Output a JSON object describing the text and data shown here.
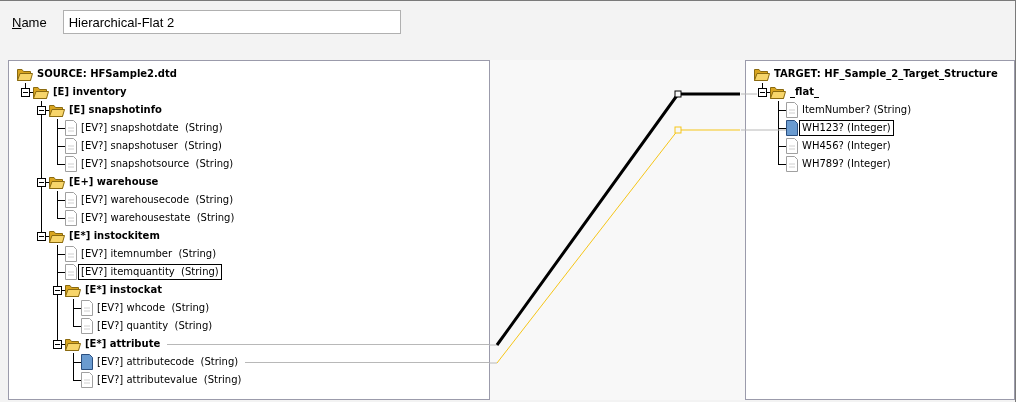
{
  "name_field": {
    "label": "Name",
    "value": "Hierarchical-Flat 2"
  },
  "source": {
    "root": {
      "label": "SOURCE: HFSample2.dtd",
      "kind": "folder",
      "mapped": false,
      "children": [
        {
          "label": "[E] inventory",
          "kind": "folder",
          "expanded": true,
          "mapped": false,
          "children": [
            {
              "label": "[E] snapshotinfo",
              "kind": "folder",
              "expanded": true,
              "mapped": false,
              "children": [
                {
                  "label": "[EV?] snapshotdate  (String)",
                  "kind": "field",
                  "mapped": false,
                  "selected": false,
                  "focused": false
                },
                {
                  "label": "[EV?] snapshotuser  (String)",
                  "kind": "field",
                  "mapped": false,
                  "selected": false,
                  "focused": false
                },
                {
                  "label": "[EV?] snapshotsource  (String)",
                  "kind": "field",
                  "mapped": false,
                  "selected": false,
                  "focused": false
                }
              ]
            },
            {
              "label": "[E+] warehouse",
              "kind": "folder",
              "expanded": true,
              "mapped": false,
              "children": [
                {
                  "label": "[EV?] warehousecode  (String)",
                  "kind": "field",
                  "mapped": false,
                  "selected": false,
                  "focused": false
                },
                {
                  "label": "[EV?] warehousestate  (String)",
                  "kind": "field",
                  "mapped": false,
                  "selected": false,
                  "focused": false
                }
              ]
            },
            {
              "label": "[E*] instockitem",
              "kind": "folder",
              "expanded": true,
              "mapped": false,
              "children": [
                {
                  "label": "[EV?] itemnumber  (String)",
                  "kind": "field",
                  "mapped": false,
                  "selected": false,
                  "focused": false
                },
                {
                  "label": "[EV?] itemquantity  (String)",
                  "kind": "field",
                  "mapped": false,
                  "selected": false,
                  "focused": true
                },
                {
                  "label": "[E*] instockat",
                  "kind": "folder",
                  "expanded": true,
                  "mapped": false,
                  "children": [
                    {
                      "label": "[EV?] whcode  (String)",
                      "kind": "field",
                      "mapped": false,
                      "selected": false,
                      "focused": false
                    },
                    {
                      "label": "[EV?] quantity  (String)",
                      "kind": "field",
                      "mapped": false,
                      "selected": false,
                      "focused": false
                    }
                  ]
                },
                {
                  "label": "[E*] attribute",
                  "kind": "folder",
                  "expanded": true,
                  "mapped": true,
                  "children": [
                    {
                      "label": "[EV?] attributecode  (String)",
                      "kind": "field",
                      "mapped": true,
                      "selected": true,
                      "focused": false
                    },
                    {
                      "label": "[EV?] attributevalue  (String)",
                      "kind": "field",
                      "mapped": false,
                      "selected": false,
                      "focused": false
                    }
                  ]
                }
              ]
            }
          ]
        }
      ]
    }
  },
  "mappings": [
    {
      "selected": true
    },
    {
      "selected": false
    }
  ],
  "target": {
    "root": {
      "label": "TARGET: HF_Sample_2_Target_Structure",
      "kind": "folder",
      "children": [
        {
          "label": "_flat_",
          "kind": "folder",
          "expanded": true,
          "children": [
            {
              "label": "ItemNumber? (String)",
              "kind": "field",
              "selected": false,
              "focused": false
            },
            {
              "label": "WH123? (Integer)",
              "kind": "field",
              "selected": true,
              "focused": true
            },
            {
              "label": "WH456? (Integer)",
              "kind": "field",
              "selected": false,
              "focused": false
            },
            {
              "label": "WH789? (Integer)",
              "kind": "field",
              "selected": false,
              "focused": false
            }
          ]
        }
      ]
    }
  }
}
